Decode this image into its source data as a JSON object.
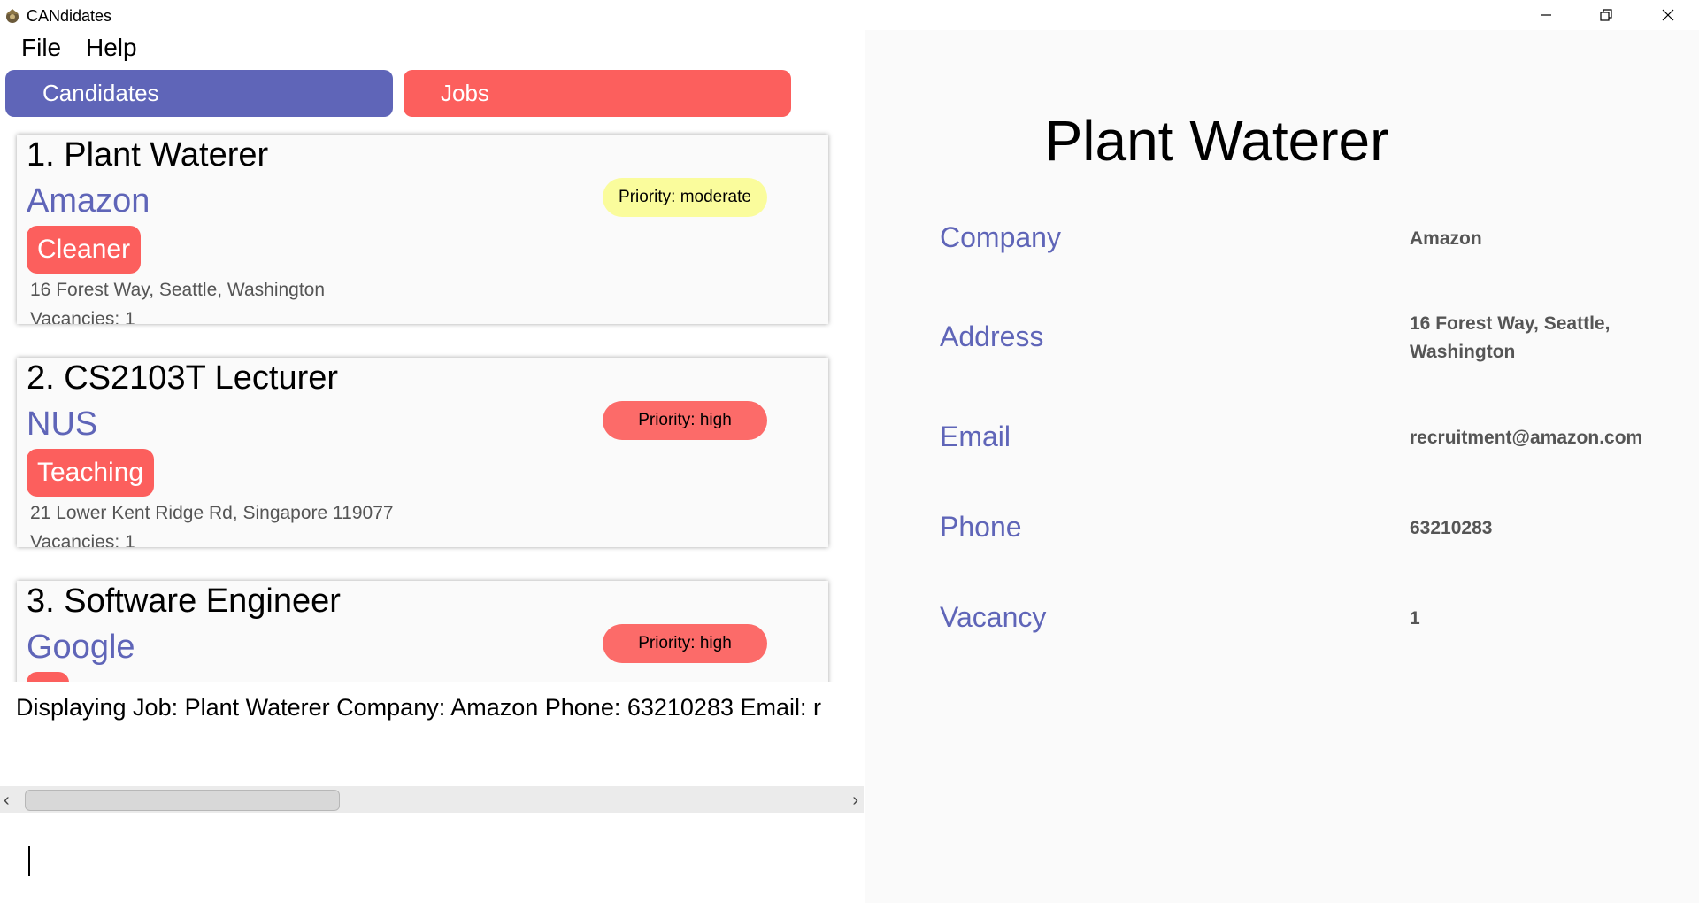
{
  "window": {
    "title": "CANdidates",
    "minimize_icon": "minimize-icon",
    "maximize_icon": "restore-icon",
    "close_icon": "close-icon"
  },
  "menu": [
    "File",
    "Help"
  ],
  "tabs": {
    "candidates": "Candidates",
    "jobs": "Jobs"
  },
  "jobs": [
    {
      "title": "1.  Plant Waterer",
      "company": "Amazon",
      "tag": "Cleaner",
      "address": "16 Forest Way, Seattle, Washington",
      "vacancies": "Vacancies: 1",
      "priority": "Priority: moderate",
      "priority_level": "moderate"
    },
    {
      "title": "2.  CS2103T Lecturer",
      "company": "NUS",
      "tag": "Teaching",
      "address": "21 Lower Kent Ridge Rd, Singapore 119077",
      "vacancies": "Vacancies: 1",
      "priority": "Priority: high",
      "priority_level": "high"
    },
    {
      "title": "3.  Software Engineer",
      "company": "Google",
      "tag": "",
      "address": "",
      "vacancies": "",
      "priority": "Priority: high",
      "priority_level": "high"
    }
  ],
  "result": {
    "text": "Displaying Job: Plant Waterer Company: Amazon Phone: 63210283 Email: r"
  },
  "detail": {
    "title": "Plant Waterer",
    "fields": [
      {
        "label": "Company",
        "value": "Amazon"
      },
      {
        "label": "Address",
        "value": "16 Forest Way, Seattle, Washington"
      },
      {
        "label": "Email",
        "value": "recruitment@amazon.com"
      },
      {
        "label": "Phone",
        "value": "63210283"
      },
      {
        "label": "Vacancy",
        "value": "1"
      }
    ]
  },
  "colors": {
    "accent_blue": "#5f65b8",
    "accent_red": "#fc5f5d",
    "priority_moderate": "#fafc9c",
    "priority_high": "#fc6b69"
  }
}
